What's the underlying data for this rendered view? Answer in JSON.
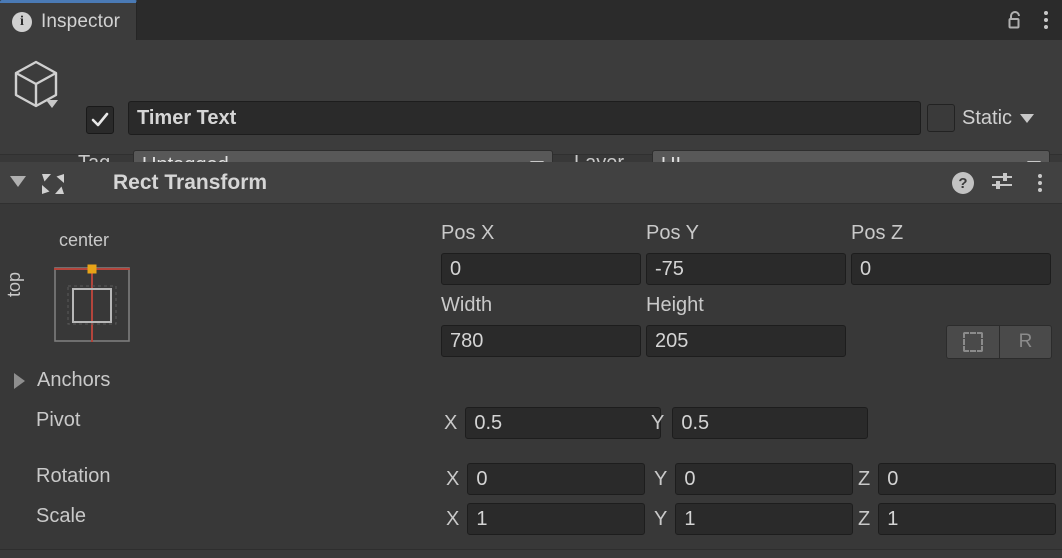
{
  "tabbar": {
    "tab_label": "Inspector",
    "info_icon": "info-icon",
    "lock_icon": "lock-open-icon",
    "menu_icon": "kebab-menu-icon"
  },
  "gameobject": {
    "icon": "cube-icon",
    "enabled": true,
    "name": "Timer Text",
    "static_label": "Static",
    "static_checked": false,
    "tag_label": "Tag",
    "tag_value": "Untagged",
    "layer_label": "Layer",
    "layer_value": "UI"
  },
  "component": {
    "title": "Rect Transform",
    "icon": "rect-transform-icon",
    "expanded": true,
    "help_icon": "help-icon",
    "preset_icon": "preset-settings-icon",
    "menu_icon": "kebab-menu-icon"
  },
  "anchor_widget": {
    "horizontal_label": "center",
    "vertical_label": "top",
    "anchor_color": "#e8a317",
    "guide_color": "#b4453c"
  },
  "fields": {
    "pos_x_label": "Pos X",
    "pos_x_value": "0",
    "pos_y_label": "Pos Y",
    "pos_y_value": "-75",
    "pos_z_label": "Pos Z",
    "pos_z_value": "0",
    "width_label": "Width",
    "width_value": "780",
    "height_label": "Height",
    "height_value": "205",
    "blueprint_button": "blueprint-mode-icon",
    "raw_button": "R"
  },
  "anchors": {
    "label": "Anchors",
    "expanded": false
  },
  "pivot": {
    "label": "Pivot",
    "x_axis": "X",
    "x_value": "0.5",
    "y_axis": "Y",
    "y_value": "0.5"
  },
  "rotation": {
    "label": "Rotation",
    "x_axis": "X",
    "x_value": "0",
    "y_axis": "Y",
    "y_value": "0",
    "z_axis": "Z",
    "z_value": "0"
  },
  "scale": {
    "label": "Scale",
    "x_axis": "X",
    "x_value": "1",
    "y_axis": "Y",
    "y_value": "1",
    "z_axis": "Z",
    "z_value": "1"
  },
  "colors": {
    "background": "#383838",
    "panel": "#3c3c3c",
    "tab_accent": "#4a7ab5",
    "field_bg": "#2a2a2a",
    "dropdown_bg": "#585858"
  }
}
